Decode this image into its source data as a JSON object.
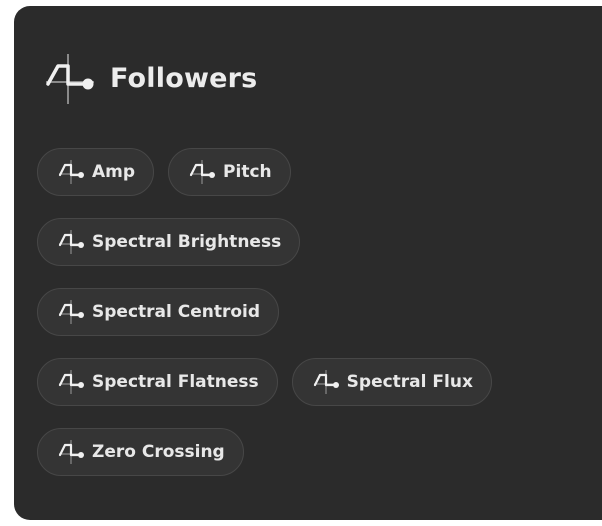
{
  "panel": {
    "title": "Followers",
    "icon": "follower-icon"
  },
  "chips": [
    [
      {
        "label": "Amp",
        "icon": "follower-icon"
      },
      {
        "label": "Pitch",
        "icon": "follower-icon"
      }
    ],
    [
      {
        "label": "Spectral Brightness",
        "icon": "follower-icon"
      }
    ],
    [
      {
        "label": "Spectral Centroid",
        "icon": "follower-icon"
      }
    ],
    [
      {
        "label": "Spectral Flatness",
        "icon": "follower-icon"
      },
      {
        "label": "Spectral Flux",
        "icon": "follower-icon"
      }
    ],
    [
      {
        "label": "Zero Crossing",
        "icon": "follower-icon"
      }
    ]
  ],
  "colors": {
    "panel_background": "#2b2b2b",
    "chip_background": "#343434",
    "chip_border": "#474747",
    "text": "#e8e8e8"
  }
}
